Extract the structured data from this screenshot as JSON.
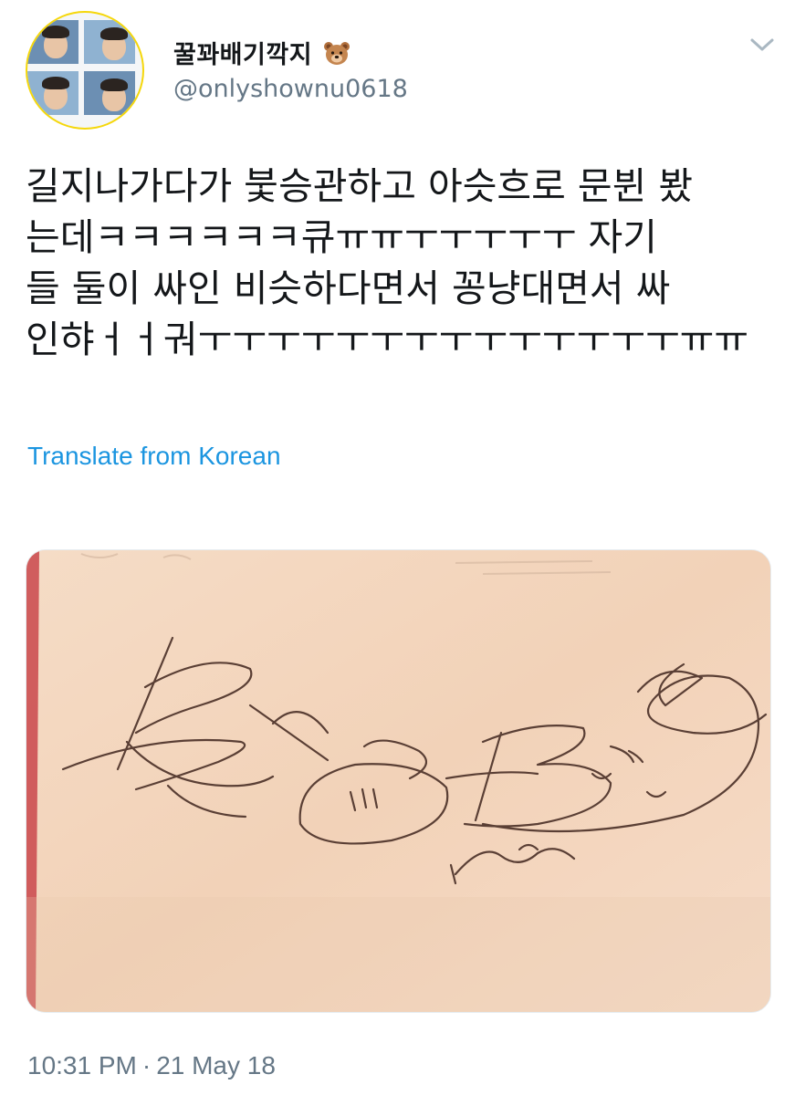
{
  "tweet": {
    "author": {
      "display_name": "꿀꽈배기깍지",
      "emoji_icon": "bear-face-icon",
      "handle": "@onlyshownu0618"
    },
    "text": "길지나가다가 붗승관하고 아슷흐로 문뷘 봤\n는데ㅋㅋㅋㅋㅋㅋ큐ㅠㅠㅜㅜㅜㅜㅜ 자기\n들 둘이 싸인 비슷하다면서 꽁냥대면서 싸\n인햐ㅓㅓ궈ㅜㅜㅜㅜㅜㅜㅜㅜㅜㅜㅜㅜㅜㅜㅠㅠ",
    "translate_label": "Translate from Korean",
    "time": "10:31 PM",
    "separator": "·",
    "date": "21 May 18"
  },
  "colors": {
    "link": "#1b95e0",
    "secondary_text": "#657786",
    "avatar_ring": "#f5d70a",
    "paper": "#f3d6bf"
  },
  "icons": {
    "menu": "chevron-down-icon"
  }
}
